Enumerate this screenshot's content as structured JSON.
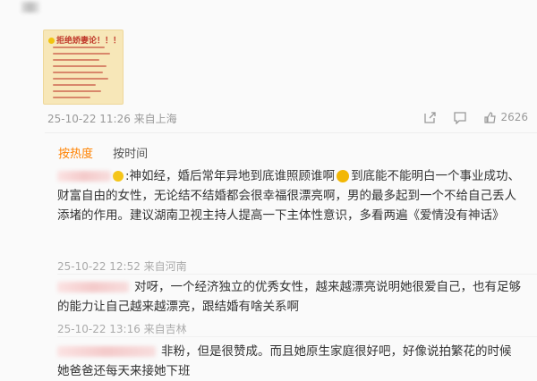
{
  "post": {
    "image_title": "拒绝娇妻论！！！",
    "meta": "25-10-22 11:26 来自上海",
    "like_count": "2626"
  },
  "sort": {
    "hot_label": "按热度",
    "time_label": "按时间"
  },
  "comments": [
    {
      "text": ":神如经，婚后常年异地到底谁照顾谁啊",
      "text2": "到底能不能明白一个事业成功、财富自由的女性，无论结不结婚都会很幸福很漂亮啊，男的最多起到一个不给自己丢人添堵的作用。建议湖南卫视主持人提高一下主体性意识，多看两遍《爱情没有神话》",
      "meta": "25-10-22 12:52 来自河南"
    },
    {
      "text": "对呀，一个经济独立的优秀女性，越来越漂亮说明她很爱自己，也有足够的能力让自己越来越漂亮，跟结婚有啥关系啊",
      "meta": "25-10-22 13:16 来自吉林"
    },
    {
      "text": "非粉，但是很赞成。而且她原生家庭很好吧，好像说拍繁花的时候她爸爸还每天来接她下班"
    }
  ]
}
